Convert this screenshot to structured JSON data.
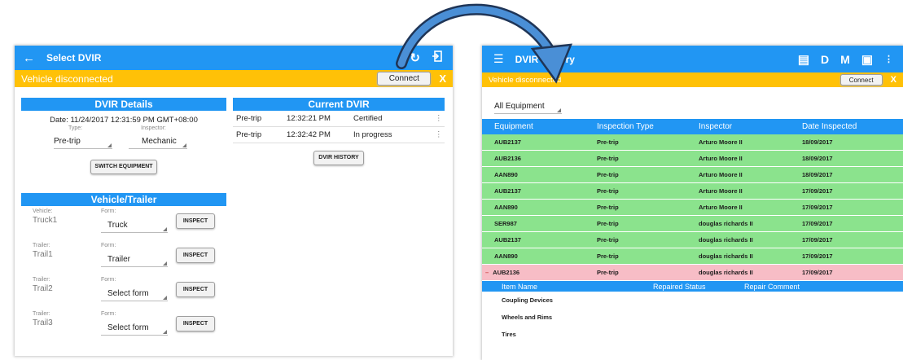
{
  "left": {
    "appbar": {
      "back_icon": "arrow-left-icon",
      "title": "Select DVIR",
      "refresh_icon": "refresh-icon",
      "logout_icon": "logout-icon"
    },
    "warning": {
      "text": "Vehicle disconnected",
      "connect": "Connect",
      "close": "X"
    },
    "dvir_details": {
      "header": "DVIR Details",
      "date": "Date: 11/24/2017 12:31:59 PM GMT+08:00",
      "type_label": "Type:",
      "inspector_label": "Inspector:",
      "type_value": "Pre-trip",
      "inspector_value": "Mechanic",
      "switch": "SWITCH EQUIPMENT"
    },
    "current_dvir": {
      "header": "Current DVIR",
      "rows": [
        {
          "type": "Pre-trip",
          "time": "12:32:21 PM",
          "status": "Certified"
        },
        {
          "type": "Pre-trip",
          "time": "12:32:42 PM",
          "status": "In progress"
        }
      ],
      "history": "DVIR HISTORY"
    },
    "vehicle_trailer": {
      "header": "Vehicle/Trailer",
      "form_label": "Form:",
      "inspect": "INSPECT",
      "rows": [
        {
          "label": "Vehicle:",
          "name": "Truck1",
          "form": "Truck"
        },
        {
          "label": "Trailer:",
          "name": "Trail1",
          "form": "Trailer"
        },
        {
          "label": "Trailer:",
          "name": "Trail2",
          "form": "Select form"
        },
        {
          "label": "Trailer:",
          "name": "Trail3",
          "form": "Select form"
        }
      ]
    }
  },
  "right": {
    "appbar": {
      "menu_icon": "menu-icon",
      "title": "DVIR History",
      "i1": "D",
      "i2": "M",
      "message_icon": "message-icon",
      "monitor_icon": "monitor-icon",
      "more_icon": "more-vertical-icon"
    },
    "warning": {
      "text": "Vehicle disconnected",
      "connect": "Connect",
      "close": "X"
    },
    "filter": "All Equipment",
    "columns": [
      "Equipment",
      "Inspection Type",
      "Inspector",
      "Date Inspected"
    ],
    "rows": [
      {
        "eq": "AUB2137",
        "type": "Pre-trip",
        "insp": "Arturo Moore II",
        "date": "18/09/2017",
        "state": "green"
      },
      {
        "eq": "AUB2136",
        "type": "Pre-trip",
        "insp": "Arturo Moore II",
        "date": "18/09/2017",
        "state": "green"
      },
      {
        "eq": "AAN890",
        "type": "Pre-trip",
        "insp": "Arturo Moore II",
        "date": "18/09/2017",
        "state": "green"
      },
      {
        "eq": "AUB2137",
        "type": "Pre-trip",
        "insp": "Arturo Moore II",
        "date": "17/09/2017",
        "state": "green"
      },
      {
        "eq": "AAN890",
        "type": "Pre-trip",
        "insp": "Arturo Moore II",
        "date": "17/09/2017",
        "state": "green"
      },
      {
        "eq": "SER987",
        "type": "Pre-trip",
        "insp": "douglas richards II",
        "date": "17/09/2017",
        "state": "green"
      },
      {
        "eq": "AUB2137",
        "type": "Pre-trip",
        "insp": "douglas richards II",
        "date": "17/09/2017",
        "state": "green"
      },
      {
        "eq": "AAN890",
        "type": "Pre-trip",
        "insp": "douglas richards II",
        "date": "17/09/2017",
        "state": "green"
      },
      {
        "eq": "AUB2136",
        "type": "Pre-trip",
        "insp": "douglas richards II",
        "date": "17/09/2017",
        "state": "pink",
        "expanded_marker": "–"
      }
    ],
    "sub_columns": [
      "Item Name",
      "Repaired Status",
      "Repair Comment"
    ],
    "sub_rows": [
      "Coupling Devices",
      "Wheels and Rims",
      "Tires"
    ]
  },
  "colors": {
    "primary": "#2196f3",
    "warning": "#ffc107",
    "ok": "#8be38d",
    "defect": "#f7bdc6"
  }
}
